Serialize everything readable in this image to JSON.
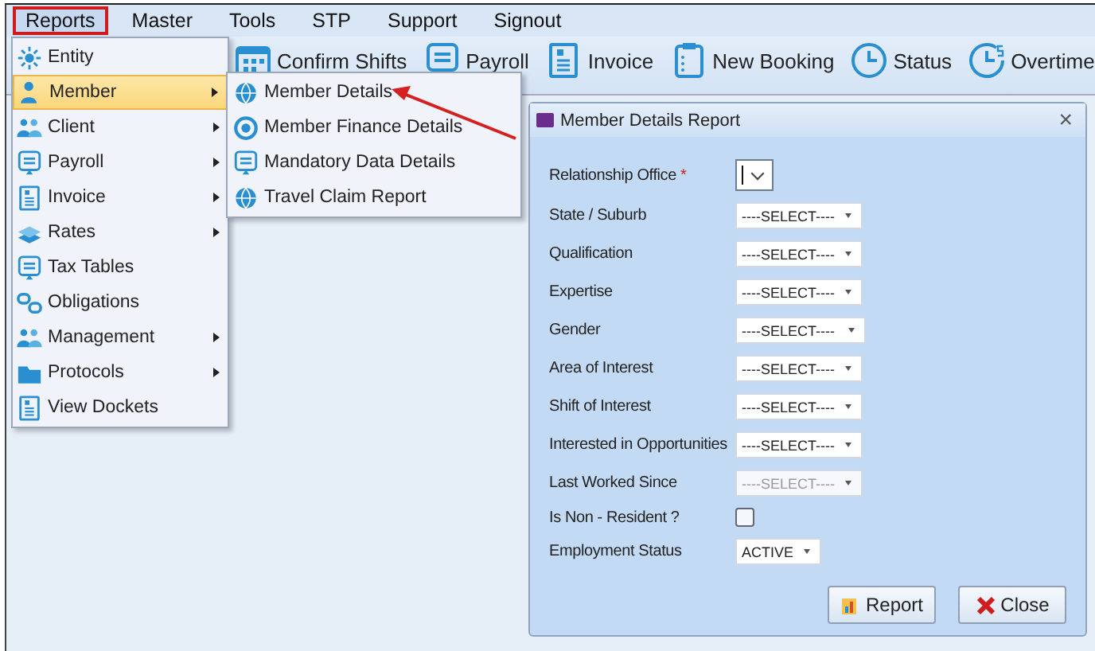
{
  "menu_bar": [
    {
      "label": "Reports",
      "selected": true
    },
    {
      "label": "Master",
      "selected": false
    },
    {
      "label": "Tools",
      "selected": false
    },
    {
      "label": "STP",
      "selected": false
    },
    {
      "label": "Support",
      "selected": false
    },
    {
      "label": "Signout",
      "selected": false
    }
  ],
  "toolbar": [
    {
      "label": "Confirm Shifts"
    },
    {
      "label": "Payroll"
    },
    {
      "label": "Invoice"
    },
    {
      "label": "New Booking"
    },
    {
      "label": "Status"
    },
    {
      "label": "Overtime"
    }
  ],
  "reports_menu": [
    {
      "label": "Entity",
      "submenu": false,
      "selected": false
    },
    {
      "label": "Member",
      "submenu": true,
      "selected": true
    },
    {
      "label": "Client",
      "submenu": true,
      "selected": false
    },
    {
      "label": "Payroll",
      "submenu": true,
      "selected": false
    },
    {
      "label": "Invoice",
      "submenu": true,
      "selected": false
    },
    {
      "label": "Rates",
      "submenu": true,
      "selected": false
    },
    {
      "label": "Tax Tables",
      "submenu": false,
      "selected": false
    },
    {
      "label": "Obligations",
      "submenu": false,
      "selected": false
    },
    {
      "label": "Management",
      "submenu": true,
      "selected": false
    },
    {
      "label": "Protocols",
      "submenu": true,
      "selected": false
    },
    {
      "label": "View Dockets",
      "submenu": false,
      "selected": false
    }
  ],
  "member_submenu": [
    {
      "label": "Member Details"
    },
    {
      "label": "Member Finance Details"
    },
    {
      "label": "Mandatory Data Details"
    },
    {
      "label": "Travel Claim Report"
    }
  ],
  "dialog": {
    "title": "Member Details Report",
    "close": "×",
    "fields": [
      {
        "label": "Relationship Office",
        "required_mark": "*",
        "kind": "input-select"
      },
      {
        "label": "State / Suburb",
        "kind": "select",
        "value": "----SELECT----"
      },
      {
        "label": "Qualification",
        "kind": "select",
        "value": "----SELECT----"
      },
      {
        "label": "Expertise",
        "kind": "select",
        "value": "----SELECT----"
      },
      {
        "label": "Gender",
        "kind": "short-select",
        "value": "----SELECT----"
      },
      {
        "label": "Area of Interest",
        "kind": "select",
        "value": "----SELECT----"
      },
      {
        "label": "Shift of Interest",
        "kind": "select",
        "value": "----SELECT----"
      },
      {
        "label": "Interested in Opportunities",
        "kind": "select",
        "value": "----SELECT----"
      },
      {
        "label": "Last Worked Since",
        "kind": "select",
        "value": "----SELECT----",
        "disabled": true
      },
      {
        "label": "Is Non - Resident ?",
        "kind": "checkbox",
        "checked": false
      },
      {
        "label": "Employment Status",
        "kind": "select",
        "value": "ACTIVE"
      }
    ],
    "buttons": [
      {
        "label": "Report",
        "kind": "report"
      },
      {
        "label": "Close",
        "kind": "close"
      }
    ]
  }
}
